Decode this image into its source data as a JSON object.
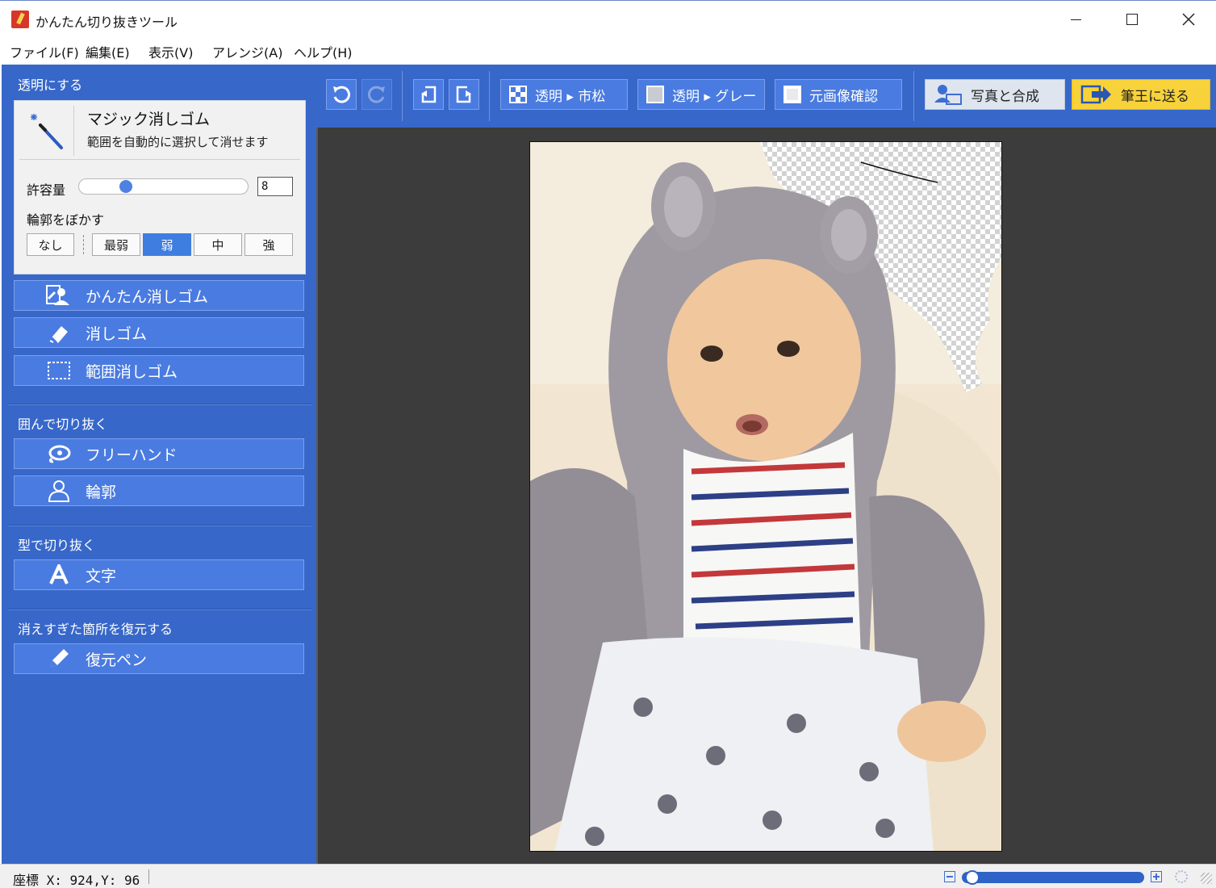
{
  "window": {
    "title": "かんたん切り抜きツール",
    "controls": [
      "minimize",
      "maximize",
      "close"
    ]
  },
  "menu": [
    "ファイル(F)",
    "編集(E)",
    "表示(V)",
    "アレンジ(A)",
    "ヘルプ(H)"
  ],
  "sidebar": {
    "transparent_section": "透明にする",
    "magic": {
      "title": "マジック消しゴム",
      "description": "範囲を自動的に選択して消せます",
      "tolerance_label": "許容量",
      "tolerance_value": "8",
      "tolerance_fraction": 0.27,
      "blur_label": "輪郭をぼかす",
      "blur_options": [
        "なし",
        "最弱",
        "弱",
        "中",
        "強"
      ],
      "blur_selected": "弱"
    },
    "erase_tools": [
      "かんたん消しゴム",
      "消しゴム",
      "範囲消しゴム"
    ],
    "enclose_section": "囲んで切り抜く",
    "enclose_tools": [
      "フリーハンド",
      "輪郭"
    ],
    "shape_section": "型で切り抜く",
    "shape_tools": [
      "文字"
    ],
    "restore_section": "消えすぎた箇所を復元する",
    "restore_tools": [
      "復元ペン"
    ]
  },
  "toolbar": {
    "transparent_checker": "透明 ▸ 市松",
    "transparent_gray": "透明 ▸ グレー",
    "original_check": "元画像確認",
    "combine_photo": "写真と合成",
    "send_to_hitsuo": "筆王に送る",
    "icons": [
      "undo-icon",
      "redo-icon",
      "rotate-left-icon",
      "rotate-right-icon"
    ]
  },
  "colors": {
    "panel": "#3767c9",
    "button": "#4a7be0",
    "active": "#3f7ee0",
    "accent_yellow": "#f7d23b",
    "canvas": "#3c3c3c"
  },
  "status": {
    "coord": "座標 X: 924,Y:  96",
    "zoom_fraction": 0.02
  }
}
